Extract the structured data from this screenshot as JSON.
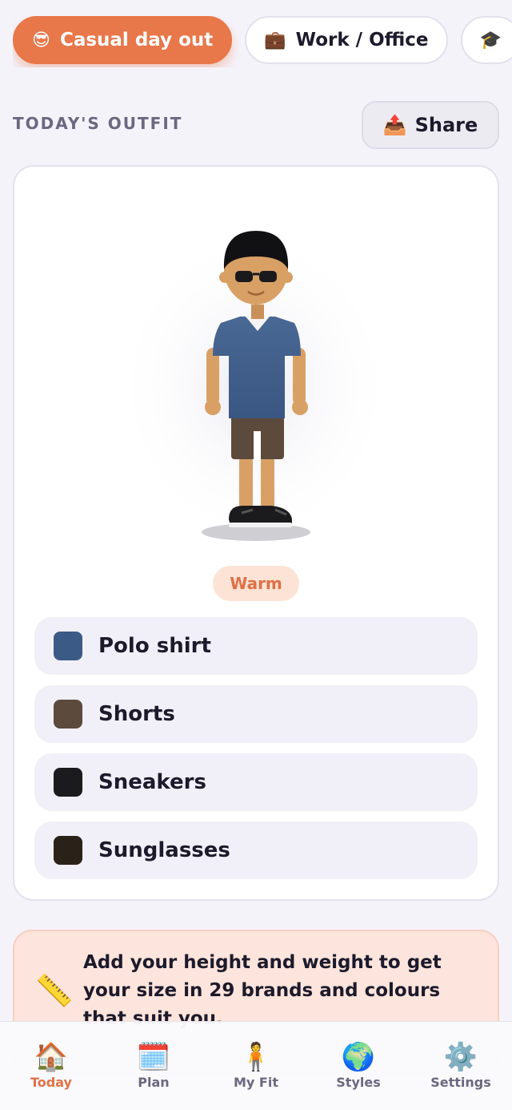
{
  "occasions": [
    {
      "icon": "😎",
      "label": "Casual day out",
      "active": true
    },
    {
      "icon": "💼",
      "label": "Work / Office",
      "active": false
    },
    {
      "icon": "🎓",
      "label": "",
      "active": false
    }
  ],
  "section": {
    "title": "TODAY'S OUTFIT",
    "share_icon": "📤",
    "share_label": "Share"
  },
  "outfit": {
    "temperature_badge": "Warm",
    "items": [
      {
        "label": "Polo shirt",
        "color": "#3c5a86"
      },
      {
        "label": "Shorts",
        "color": "#5c4a3d"
      },
      {
        "label": "Sneakers",
        "color": "#1b1b1d"
      },
      {
        "label": "Sunglasses",
        "color": "#2a2118"
      }
    ]
  },
  "banner": {
    "icon": "📏",
    "text": "Add your height and weight to get your size in 29 brands and colours that suit you."
  },
  "tabs": [
    {
      "icon": "🏠",
      "label": "Today",
      "active": true
    },
    {
      "icon": "🗓️",
      "label": "Plan",
      "active": false
    },
    {
      "icon": "🧍",
      "label": "My Fit",
      "active": false
    },
    {
      "icon": "🌍",
      "label": "Styles",
      "active": false
    },
    {
      "icon": "⚙️",
      "label": "Settings",
      "active": false
    }
  ],
  "colors": {
    "accent": "#e8774a",
    "skin": "#d9a066",
    "shirt": "#3c5a86",
    "shorts": "#5c4a3d",
    "shoes": "#1b1b1d"
  }
}
